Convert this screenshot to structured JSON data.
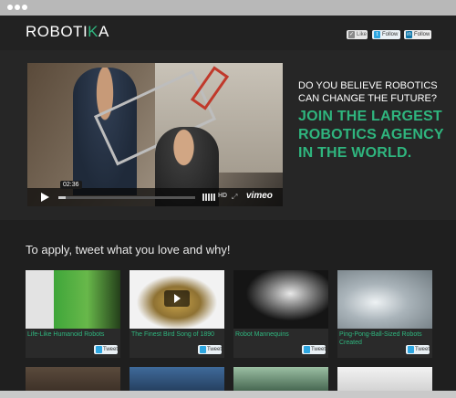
{
  "brand": {
    "logo_main": "ROBOTI",
    "logo_accent": "K",
    "logo_end": "A"
  },
  "header": {
    "like_label": "Like",
    "twitter_follow_label": "Follow",
    "linkedin_follow_label": "Follow"
  },
  "hero": {
    "question": "DO YOU BELIEVE ROBOTICS CAN CHANGE THE FUTURE?",
    "cta": "JOIN THE LARGEST ROBOTICS AGENCY IN THE WORLD.",
    "video": {
      "timecode": "02:36",
      "hd_label": "HD",
      "player_brand": "vimeo",
      "progress": 0.05
    }
  },
  "section": {
    "title": "To apply, tweet what you love and why!"
  },
  "cards": [
    {
      "caption": "Life-Like Humanoid Robots",
      "tweet_label": "Tweet"
    },
    {
      "caption": "The Finest Bird Song of 1890",
      "tweet_label": "Tweet"
    },
    {
      "caption": "Robot Mannequins",
      "tweet_label": "Tweet"
    },
    {
      "caption": "Ping-Pong-Ball-Sized Robots Created",
      "tweet_label": "Tweet"
    }
  ],
  "colors": {
    "accent": "#2fb57e",
    "background": "#1f1f1f",
    "hero_bg": "#262626"
  },
  "icons": [
    "play-icon",
    "volume-icon",
    "fullscreen-icon",
    "twitter-icon",
    "linkedin-icon",
    "like-icon"
  ]
}
